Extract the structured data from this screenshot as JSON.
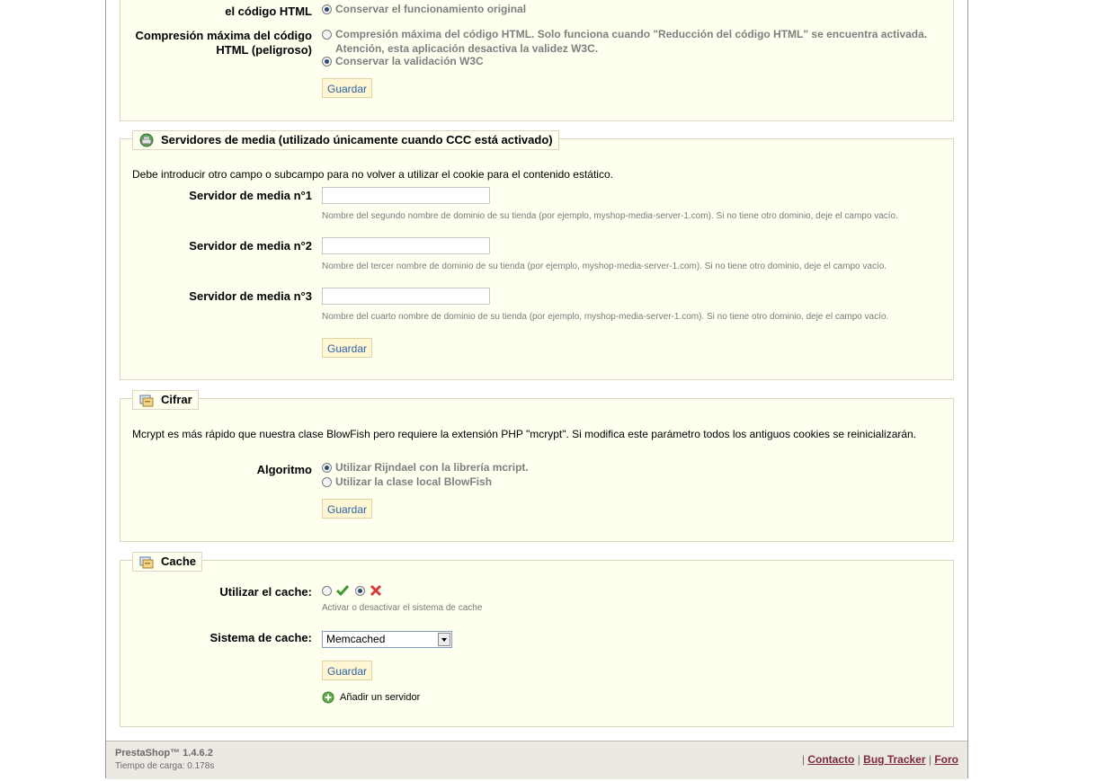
{
  "html_compression": {
    "label_top_line": "el código HTML",
    "opt_preserve": "Conservar el funcionamiento original",
    "label_max": "Compresión máxima del código HTML (peligroso)",
    "opt_max": "Compresión máxima del código HTML. Solo funciona cuando \"Reducción del código HTML\" se encuentra activada. Atención, esta aplicación desactiva la validez W3C.",
    "opt_w3c": "Conservar la validación W3C",
    "save": "Guardar"
  },
  "media_servers": {
    "title": "Servidores de media (utilizado únicamente cuando CCC está activado)",
    "intro": "Debe introducir otro campo o subcampo para no volver a utilizar el cookie para el contenido estático.",
    "servers": [
      {
        "label": "Servidor de media n°1",
        "value": "",
        "hint": "Nombre del segundo nombre de dominio de su tienda (por ejemplo, myshop-media-server-1.com). Si no tiene otro dominio, deje el campo vacío."
      },
      {
        "label": "Servidor de media n°2",
        "value": "",
        "hint": "Nombre del tercer nombre de dominio de su tienda (por ejemplo, myshop-media-server-1.com). Si no tiene otro dominio, deje el campo vacío."
      },
      {
        "label": "Servidor de media n°3",
        "value": "",
        "hint": "Nombre del cuarto nombre de dominio de su tienda (por ejemplo, myshop-media-server-1.com). Si no tiene otro dominio, deje el campo vacío."
      }
    ],
    "save": "Guardar"
  },
  "cipher": {
    "title": "Cifrar",
    "intro": "Mcrypt es más rápido que nuestra clase BlowFish pero requiere la extensión PHP \"mcrypt\". Si modifica este parámetro todos los antiguos cookies se reinicializarán.",
    "algo_label": "Algoritmo",
    "opt_rijndael": "Utilizar Rijndael con la librería mcript.",
    "opt_blowfish": "Utilizar la clase local BlowFish",
    "save": "Guardar"
  },
  "cache": {
    "title": "Cache",
    "use_label": "Utilizar el cache:",
    "use_hint": "Activar o desactivar el sistema de cache",
    "system_label": "Sistema de cache:",
    "system_value": "Memcached",
    "save": "Guardar",
    "add_server": "Añadir un servidor"
  },
  "footer": {
    "version": "PrestaShop™ 1.4.6.2",
    "load_time": "Tiempo de carga: 0.178s",
    "links": [
      "Contacto",
      "Bug Tracker",
      "Foro"
    ]
  },
  "colors": {
    "panel_bg": "#fffff0",
    "panel_border": "#dfd5c3",
    "button_text": "#2a64a6",
    "link": "#7c2a3a"
  }
}
